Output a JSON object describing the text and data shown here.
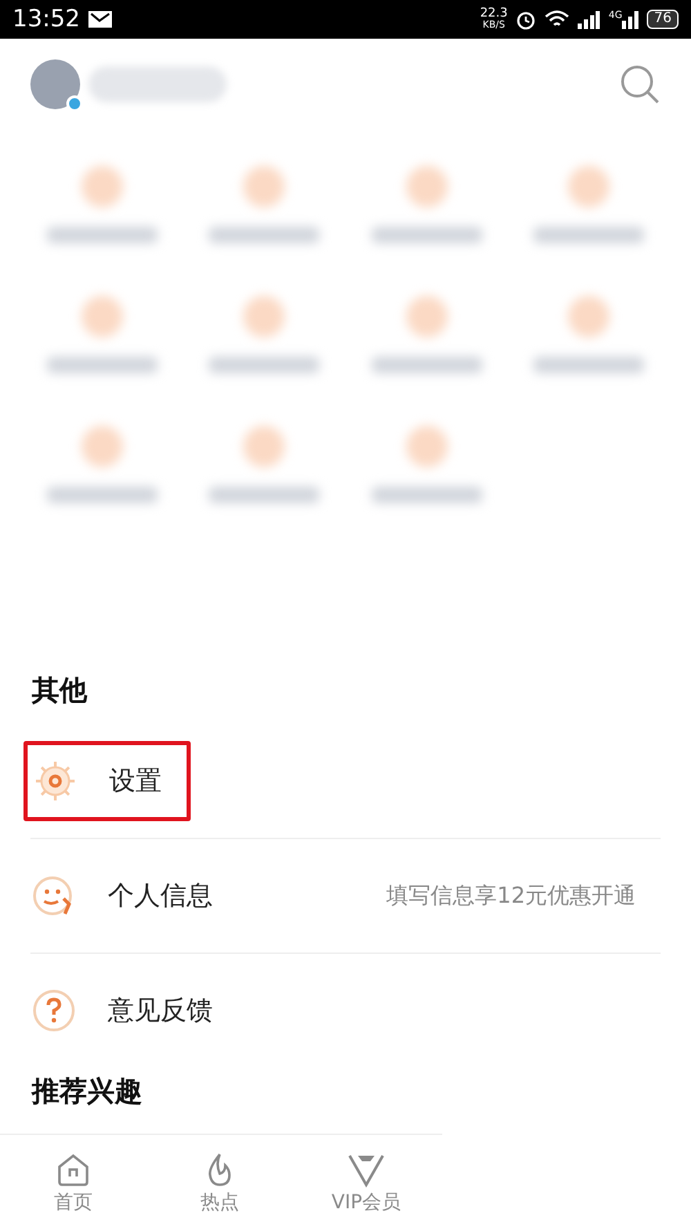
{
  "status_bar": {
    "time": "13:52",
    "speed": "22.3",
    "speed_unit": "KB/S",
    "network": "4G",
    "battery": "76"
  },
  "grid": {
    "tiles": [
      {
        "kind": "blurred"
      },
      {
        "kind": "blurred"
      },
      {
        "kind": "blurred"
      },
      {
        "kind": "blurred"
      },
      {
        "kind": "blurred"
      },
      {
        "kind": "blurred"
      },
      {
        "kind": "blurred"
      },
      {
        "kind": "blurred"
      },
      {
        "kind": "blurred"
      },
      {
        "kind": "blurred"
      },
      {
        "kind": "blurred"
      }
    ]
  },
  "section": {
    "title": "其他"
  },
  "items": [
    {
      "kind": "settings",
      "label": "设置",
      "highlighted": true
    },
    {
      "kind": "profile",
      "label": "个人信息",
      "hint": "填写信息享12元优惠开通",
      "highlighted": false
    },
    {
      "kind": "feedback",
      "label": "意见反馈",
      "highlighted": false
    }
  ],
  "next_section": {
    "title": "推荐兴趣"
  },
  "tabs": [
    {
      "kind": "home",
      "label": "首页",
      "selected": false
    },
    {
      "kind": "hot",
      "label": "热点",
      "selected": false
    },
    {
      "kind": "vip",
      "label": "VIP会员",
      "selected": false
    }
  ]
}
